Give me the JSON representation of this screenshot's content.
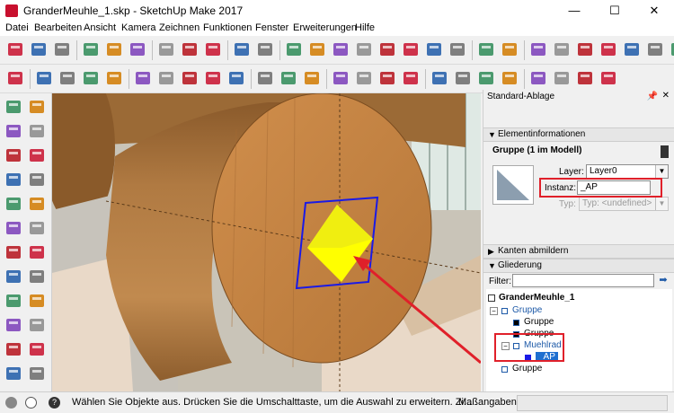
{
  "window": {
    "title": "GranderMeuhle_1.skp - SketchUp Make 2017",
    "minimize_glyph": "—",
    "maximize_glyph": "☐",
    "close_glyph": "✕"
  },
  "menu": [
    "Datei",
    "Bearbeiten",
    "Ansicht",
    "Kamera",
    "Zeichnen",
    "Funktionen",
    "Fenster",
    "Erweiterungen",
    "Hilfe"
  ],
  "icons": {
    "toolbar1": [
      "new-file-icon",
      "open-file-icon",
      "save-icon",
      "cut-icon",
      "copy-icon",
      "paste-icon",
      "erase-icon",
      "undo-icon",
      "redo-icon",
      "print-icon",
      "model-info-icon",
      "pencil-icon",
      "freehand-icon",
      "rectangle-icon",
      "circle-icon",
      "polygon-icon",
      "arc-icon",
      "pie-icon",
      "arc2-icon",
      "warehouse-icon",
      "share-model-icon",
      "home-icon",
      "iso-view-icon",
      "top-view-icon",
      "front-view-icon",
      "right-view-icon",
      "back-view-icon",
      "left-view-icon"
    ],
    "toolbar2": [
      "select-icon",
      "eraser-icon",
      "line-icon",
      "arc-icon",
      "shapes-icon",
      "push-pull-icon",
      "move-icon",
      "rotate-icon",
      "scale-icon",
      "offset-icon",
      "tape-measure-icon",
      "text-icon",
      "paint-bucket-icon",
      "orbit-icon",
      "pan-icon",
      "zoom-icon",
      "zoom-extents-icon",
      "warehouse-icon",
      "extension-warehouse-icon",
      "layout-icon",
      "ruby-icon",
      "position-camera-icon",
      "walk-icon",
      "look-around-icon",
      "section-plane-icon"
    ],
    "lefttb": [
      "select-icon",
      "component-icon",
      "paint-bucket-icon",
      "eraser-icon",
      "line-icon",
      "freehand-icon",
      "rectangle-icon",
      "rotated-rect-icon",
      "circle-icon",
      "polygon-icon",
      "arc-icon",
      "arc3-icon",
      "arc-3pt-icon",
      "pie-icon",
      "move-icon",
      "push-pull-icon",
      "rotate-icon",
      "follow-me-icon",
      "scale-icon",
      "offset-icon",
      "tape-measure-icon",
      "dimension-icon",
      "protractor-icon",
      "text-icon"
    ]
  },
  "colors": {
    "red_highlight": "#e0202a",
    "selection_blue": "#1a1ae6",
    "face_yellow": "#ffff00",
    "wood": "#b9814a"
  },
  "panel": {
    "tray_title": "Standard-Ablage",
    "pin_glyph": "📌",
    "close_glyph": "✕",
    "entity_info": {
      "header": "Elementinformationen",
      "title": "Gruppe (1 im Modell)",
      "layer_label": "Layer:",
      "layer_value": "Layer0",
      "instance_label": "Instanz:",
      "instance_value": "_AP",
      "type_label": "Typ:",
      "type_value": "Typ: <undefined>"
    },
    "soften_header": "Kanten abmildern",
    "outliner": {
      "header": "Gliederung",
      "filter_label": "Filter:",
      "filter_value": "",
      "root": "GranderMeuhle_1",
      "items": [
        {
          "label": "Gruppe",
          "expander": "⊟",
          "selected": false
        },
        {
          "label": "Gruppe",
          "expander": "",
          "selected": false
        },
        {
          "label": "Gruppe",
          "expander": "",
          "selected": false
        },
        {
          "label": "Muehlrad",
          "expander": "⊟",
          "selected": false
        },
        {
          "label": "_AP",
          "expander": "",
          "selected": true
        },
        {
          "label": "Gruppe",
          "expander": "",
          "selected": false
        }
      ]
    }
  },
  "status": {
    "text": "Wählen Sie Objekte aus. Drücken Sie die Umschalttaste, um die Auswahl zu erweitern. Zi...",
    "measure_label": "Maßangaben",
    "measure_value": ""
  }
}
